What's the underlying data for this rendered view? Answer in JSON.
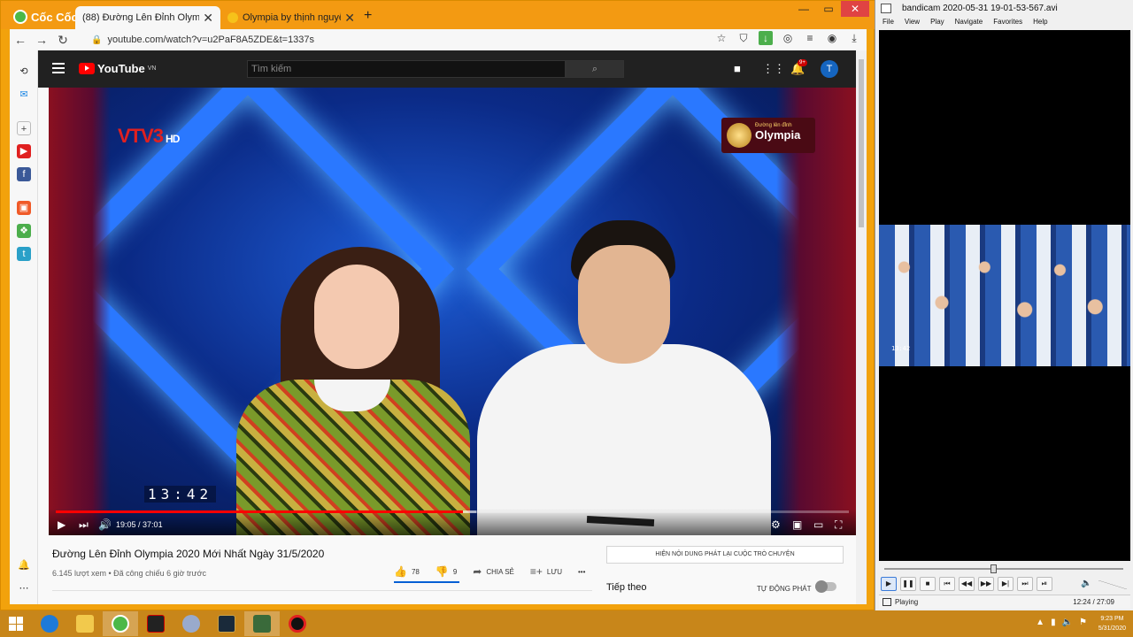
{
  "browser": {
    "brand": "Cốc Cốc",
    "tabs": [
      {
        "title": "(88) Đường Lên Đỉnh Olympi",
        "active": true
      },
      {
        "title": "Olympia by thịnh nguyễn cha",
        "active": false
      }
    ],
    "url": "youtube.com/watch?v=u2PaF8A5ZDE&t=1337s",
    "window_controls": {
      "minimize": "—",
      "maximize": "▭",
      "close": "✕"
    }
  },
  "youtube": {
    "logo_text": "YouTube",
    "logo_region": "VN",
    "search_placeholder": "Tìm kiếm",
    "notif_count": "9+",
    "avatar_letter": "T",
    "video": {
      "channel_logo": "VTV3",
      "channel_hd": "HD",
      "show_logo_small": "Đường lên đỉnh",
      "show_logo": "Olympia",
      "clock_overlay": "13:42",
      "time_current": "19:05",
      "time_total": "37:01",
      "progress": 0.513,
      "buffered": 0.53
    },
    "title": "Đường Lên Đỉnh Olympia 2020 Mới Nhất Ngày 31/5/2020",
    "views": "6.145 lượt xem",
    "premiered": "Đã công chiếu 6 giờ trước",
    "likes": "78",
    "dislikes": "9",
    "share_label": "CHIA SẺ",
    "save_label": "LƯU",
    "more_label": "•••",
    "live_chat_label": "HIỆN NỘI DUNG PHÁT LẠI CUỘC TRÒ CHUYỆN",
    "up_next": "Tiếp theo",
    "autoplay": "TỰ ĐỘNG PHÁT"
  },
  "player": {
    "title": "bandicam 2020-05-31 19-01-53-567.avi",
    "menu": [
      "File",
      "View",
      "Play",
      "Navigate",
      "Favorites",
      "Help"
    ],
    "clock_overlay": "13:42",
    "status": "Playing",
    "time": "12:24 / 27:09",
    "progress": 0.457
  },
  "taskbar": {
    "clock_time": "9:23 PM",
    "clock_date": "5/31/2020"
  },
  "colors": {
    "browser_chrome": "#f39a12",
    "taskbar": "#c8861a",
    "youtube_red": "#ff0000",
    "youtube_dark": "#212121"
  }
}
